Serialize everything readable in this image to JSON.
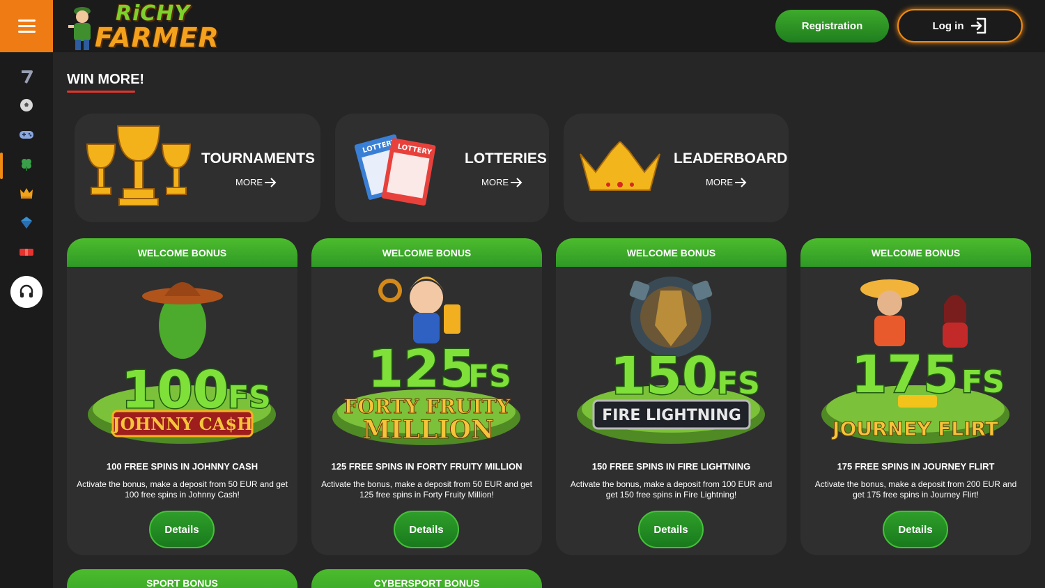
{
  "header": {
    "logo_line1": "RiCHY",
    "logo_line2": "FARMER",
    "registration_label": "Registration",
    "login_label": "Log in"
  },
  "sidebar": {
    "items": [
      {
        "icon": "slot-seven-icon",
        "color": "#9aa0b4"
      },
      {
        "icon": "soccer-ball-icon",
        "color": "#d9d9d9"
      },
      {
        "icon": "gamepad-icon",
        "color": "#8aa7e0"
      },
      {
        "icon": "clover-icon",
        "color": "#3aa14a",
        "active": true
      },
      {
        "icon": "crown-icon",
        "color": "#f0a21b"
      },
      {
        "icon": "diamond-icon",
        "color": "#3b8fd1"
      },
      {
        "icon": "gift-icon",
        "color": "#e5332f"
      }
    ],
    "support_icon": "headset-icon"
  },
  "main": {
    "section_title": "WIN MORE!",
    "promos": [
      {
        "title": "TOURNAMENTS",
        "more": "MORE",
        "icon": "trophy-icon"
      },
      {
        "title": "LOTTERIES",
        "more": "MORE",
        "icon": "lottery-ticket-icon"
      },
      {
        "title": "LEADERBOARD",
        "more": "MORE",
        "icon": "crown-icon"
      }
    ],
    "bonuses": [
      {
        "header": "WELCOME BONUS",
        "fs": "100",
        "fs_suffix": "FS",
        "game_logo": "JOHNNY CA$H",
        "title": "100 FREE SPINS IN JOHNNY CASH",
        "description": "Activate the bonus, make a deposit from 50 EUR and get 100 free spins in Johnny Cash!",
        "button": "Details"
      },
      {
        "header": "WELCOME BONUS",
        "fs": "125",
        "fs_suffix": "FS",
        "game_logo": "FORTY FRUITY",
        "game_logo_2": "MILLION",
        "title": "125 FREE SPINS IN FORTY FRUITY MILLION",
        "description": "Activate the bonus, make a deposit from 50 EUR and get 125 free spins in Forty Fruity Million!",
        "button": "Details"
      },
      {
        "header": "WELCOME BONUS",
        "fs": "150",
        "fs_suffix": "FS",
        "game_logo": "FIRE LIGHTNING",
        "title": "150 FREE SPINS IN FIRE LIGHTNING",
        "description": "Activate the bonus, make a deposit from 100 EUR and get 150 free spins in Fire Lightning!",
        "button": "Details"
      },
      {
        "header": "WELCOME BONUS",
        "fs": "175",
        "fs_suffix": "FS",
        "game_logo": "JOURNEY FLIRT",
        "title": "175 FREE SPINS IN JOURNEY FLIRT",
        "description": "Activate the bonus, make a deposit from 200 EUR and get 175 free spins in Journey Flirt!",
        "button": "Details"
      }
    ],
    "lower_bonuses": [
      {
        "header": "SPORT BONUS"
      },
      {
        "header": "CYBERSPORT BONUS"
      }
    ]
  },
  "colors": {
    "accent_orange": "#ee7b14",
    "brand_green": "#3eaa2c",
    "background": "#262626",
    "card": "#2f2f2f"
  }
}
